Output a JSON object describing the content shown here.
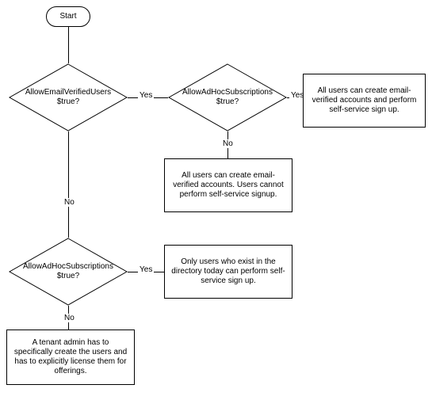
{
  "start_label": "Start",
  "decisions": {
    "d1": {
      "line1": "AllowEmailVerifiedUsers",
      "line2": "$true?"
    },
    "d2": {
      "line1": "AllowAdHocSubscriptions",
      "line2": "$true?"
    },
    "d3": {
      "line1": "AllowAdHocSubscriptions",
      "line2": "$true?"
    }
  },
  "outcomes": {
    "o1": "All users can create email-verified accounts and perform self-service sign up.",
    "o2": "All users can create email-verified accounts. Users cannot perform self-service signup.",
    "o3": "Only users who exist in the directory today can perform self-service sign up.",
    "o4": "A tenant admin has to specifically create the users and has to explicitly license them for offerings."
  },
  "edges": {
    "d1_yes": "Yes",
    "d1_no": "No",
    "d2_yes": "Yes",
    "d2_no": "No",
    "d3_yes": "Yes",
    "d3_no": "No"
  }
}
